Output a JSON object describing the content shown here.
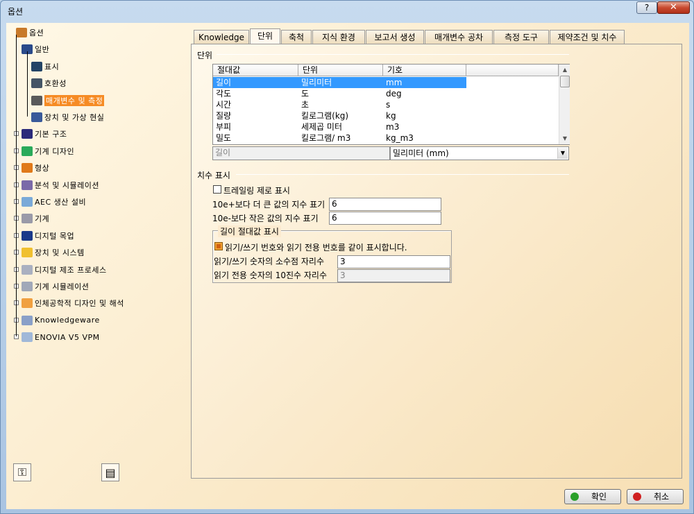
{
  "window": {
    "title": "옵션",
    "help_label": "?",
    "close_label": "✕"
  },
  "tree": {
    "items": [
      {
        "label": "옵션",
        "icon": "options-icon",
        "color": "#c87a2a"
      },
      {
        "label": "일반",
        "icon": "general-icon",
        "color": "#2a4a8a"
      },
      {
        "label": "표시",
        "icon": "display-icon",
        "color": "#224466"
      },
      {
        "label": "호환성",
        "icon": "compatibility-icon",
        "color": "#445566"
      },
      {
        "label": "매개변수 및 측정",
        "icon": "parameters-measure-icon",
        "color": "#5a5a5a",
        "selected": true
      },
      {
        "label": "장치 및 가상 현실",
        "icon": "devices-vr-icon",
        "color": "#3a5a9a"
      },
      {
        "label": "기본 구조",
        "icon": "infrastructure-icon",
        "color": "#2a2a7a"
      },
      {
        "label": "기계 디자인",
        "icon": "mechanical-design-icon",
        "color": "#2aaa5a"
      },
      {
        "label": "형상",
        "icon": "shape-icon",
        "color": "#e07a1a"
      },
      {
        "label": "분석 및 시뮬레이션",
        "icon": "analysis-simulation-icon",
        "color": "#7a6aa8"
      },
      {
        "label": "AEC 생산 설비",
        "icon": "aec-plant-icon",
        "color": "#7aaad8"
      },
      {
        "label": "기계",
        "icon": "machining-icon",
        "color": "#9a9aa8"
      },
      {
        "label": "디지털 목업",
        "icon": "digital-mockup-icon",
        "color": "#1a3a8a"
      },
      {
        "label": "장치 및 시스템",
        "icon": "equipment-systems-icon",
        "color": "#f0c030"
      },
      {
        "label": "디지털 제조 프로세스",
        "icon": "digital-process-icon",
        "color": "#aab0c0"
      },
      {
        "label": "기계 시뮬레이션",
        "icon": "machining-simulation-icon",
        "color": "#a0a8b8"
      },
      {
        "label": "인체공학적 디자인 및 해석",
        "icon": "ergonomics-icon",
        "color": "#f0a040"
      },
      {
        "label": "Knowledgeware",
        "icon": "knowledgeware-icon",
        "color": "#8aa0c8"
      },
      {
        "label": "ENOVIA V5 VPM",
        "icon": "enovia-icon",
        "color": "#a0b8d8"
      }
    ],
    "tool1_icon": "lock-settings-icon",
    "tool2_icon": "options-list-icon"
  },
  "tabs": [
    {
      "label": "Knowledge"
    },
    {
      "label": "단위",
      "active": true
    },
    {
      "label": "축척"
    },
    {
      "label": "지식 환경"
    },
    {
      "label": "보고서 생성"
    },
    {
      "label": "매개변수 공차"
    },
    {
      "label": "측정 도구"
    },
    {
      "label": "제약조건 및 치수"
    }
  ],
  "units": {
    "group_label": "단위",
    "columns": [
      "절대값",
      "단위",
      "기호"
    ],
    "rows": [
      [
        "길이",
        "밀리미터",
        "mm"
      ],
      [
        "각도",
        "도",
        "deg"
      ],
      [
        "시간",
        "초",
        "s"
      ],
      [
        "질량",
        "킬로그램(kg)",
        "kg"
      ],
      [
        "부피",
        "세제곱 미터",
        "m3"
      ],
      [
        "밀도",
        "킬로그램/ m3",
        "kg_m3"
      ]
    ],
    "selected_index": 0,
    "selected_magnitude": "길이",
    "selected_unit": "밀리미터 (mm)"
  },
  "dimension": {
    "group_label": "치수 표시",
    "trailing_zero_label": "트레일링 제로 표시",
    "trailing_zero_checked": false,
    "exp_large_label": "10e+보다 더 큰 값의 지수 표기",
    "exp_large_value": "6",
    "exp_small_label": "10e-보다 작은 값의 지수 표기",
    "exp_small_value": "6"
  },
  "length_display": {
    "group_label": "길이 절대값 표시",
    "same_display_label": "읽기/쓰기 번호와  읽기 전용 번호를 같이 표시합니다.",
    "same_display_checked": true,
    "rw_decimal_label": "읽기/쓰기 숫자의 소수점 자리수",
    "rw_decimal_value": "3",
    "ro_decimal_label": "읽기 전용 숫자의 10진수 자리수",
    "ro_decimal_value": "3"
  },
  "buttons": {
    "ok_label": "확인",
    "ok_color": "#2aa02a",
    "cancel_label": "취소",
    "cancel_color": "#d02020"
  }
}
